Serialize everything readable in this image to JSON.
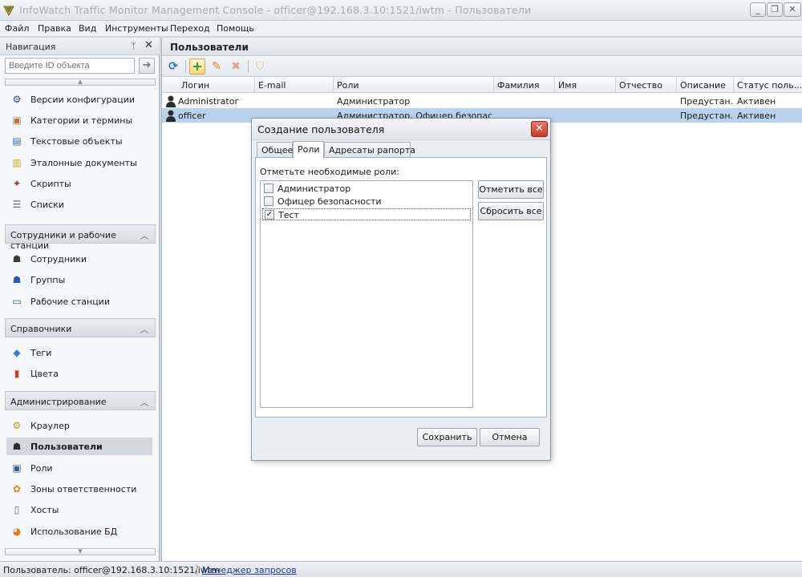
{
  "window": {
    "title": "InfoWatch Traffic Monitor Management Console - officer@192.168.3.10:1521/iwtm - Пользователи",
    "controls": {
      "minimize": "_",
      "restore": "❐",
      "close": "✕"
    }
  },
  "menu": [
    "Файл",
    "Правка",
    "Вид",
    "Инструменты",
    "Переход",
    "Помощь"
  ],
  "navigation": {
    "title": "Навигация",
    "pin": "ᛘ",
    "close": "✕",
    "id_placeholder": "Введите ID объекта",
    "go": "➜",
    "scroll_up": "▲",
    "scroll_down": "▼",
    "top_items": [
      {
        "label": "Версии конфигурации",
        "icon": "gear-icon",
        "glyph": "⚙",
        "color": "#2a4d9b"
      },
      {
        "label": "Категории и термины",
        "icon": "categories-icon",
        "glyph": "▣",
        "color": "#c0703a"
      },
      {
        "label": "Текстовые объекты",
        "icon": "text-objects-icon",
        "glyph": "▤",
        "color": "#3a6aa8"
      },
      {
        "label": "Эталонные документы",
        "icon": "reference-docs-icon",
        "glyph": "▥",
        "color": "#d4a21a"
      },
      {
        "label": "Скрипты",
        "icon": "scripts-icon",
        "glyph": "✦",
        "color": "#b0302a"
      },
      {
        "label": "Списки",
        "icon": "lists-icon",
        "glyph": "☰",
        "color": "#6a6a6a"
      }
    ],
    "groups": [
      {
        "label": "Сотрудники и рабочие станции",
        "chevron": "︿",
        "items": [
          {
            "label": "Сотрудники",
            "icon": "employees-icon",
            "glyph": "☗",
            "color": "#3b3b3b"
          },
          {
            "label": "Группы",
            "icon": "groups-icon",
            "glyph": "☗",
            "color": "#2f5ba0"
          },
          {
            "label": "Рабочие станции",
            "icon": "workstations-icon",
            "glyph": "▭",
            "color": "#345a8a"
          }
        ]
      },
      {
        "label": "Справочники",
        "chevron": "︿",
        "items": [
          {
            "label": "Теги",
            "icon": "tags-icon",
            "glyph": "◆",
            "color": "#3a7bd5"
          },
          {
            "label": "Цвета",
            "icon": "colors-icon",
            "glyph": "▮",
            "color": "#c8402a"
          }
        ]
      },
      {
        "label": "Администрирование",
        "chevron": "︿",
        "items": [
          {
            "label": "Краулер",
            "icon": "crawler-icon",
            "glyph": "⚙",
            "color": "#c9a227"
          },
          {
            "label": "Пользователи",
            "icon": "users-icon",
            "glyph": "☗",
            "color": "#2b2b2b",
            "selected": true
          },
          {
            "label": "Роли",
            "icon": "roles-icon",
            "glyph": "▣",
            "color": "#2f5ba0"
          },
          {
            "label": "Зоны ответственности",
            "icon": "zones-icon",
            "glyph": "✿",
            "color": "#d08a1a"
          },
          {
            "label": "Хосты",
            "icon": "hosts-icon",
            "glyph": "▯",
            "color": "#5a6a7a"
          },
          {
            "label": "Использование БД",
            "icon": "db-usage-icon",
            "glyph": "◕",
            "color": "#e07a1a"
          }
        ]
      }
    ]
  },
  "main": {
    "title": "Пользователи",
    "toolbar": {
      "refresh": "⟳",
      "add": "+",
      "edit": "✎",
      "delete": "✖",
      "filter": "⛉"
    },
    "columns": [
      "Логин",
      "E-mail",
      "Роли",
      "Фамилия",
      "Имя",
      "Отчество",
      "Описание",
      "Статус поль..."
    ],
    "rows": [
      {
        "login": "Administrator",
        "email": "",
        "roles": "Администратор",
        "surname": "",
        "name": "",
        "patronymic": "",
        "description": "Предустан...",
        "status": "Активен"
      },
      {
        "login": "officer",
        "email": "",
        "roles": "Администратор, Офицер безопасности",
        "surname": "",
        "name": "",
        "patronymic": "",
        "description": "Предустан...",
        "status": "Активен"
      }
    ]
  },
  "dialog": {
    "title": "Создание пользователя",
    "close": "✕",
    "tabs": [
      "Общее",
      "Роли",
      "Адресаты рапорта"
    ],
    "active_tab": "Роли",
    "hint": "Отметьте необходимые роли:",
    "roles": [
      {
        "label": "Администратор",
        "checked": false,
        "mark": ""
      },
      {
        "label": "Офицер безопасности",
        "checked": false,
        "mark": ""
      },
      {
        "label": "Тест",
        "checked": true,
        "mark": "✓"
      }
    ],
    "check_all": "Отметить все",
    "reset_all": "Сбросить все",
    "save": "Сохранить",
    "cancel": "Отмена"
  },
  "status_bar": {
    "user": "Пользователь: officer@192.168.3.10:1521/iwtm",
    "query_manager": "Менеджер запросов"
  }
}
